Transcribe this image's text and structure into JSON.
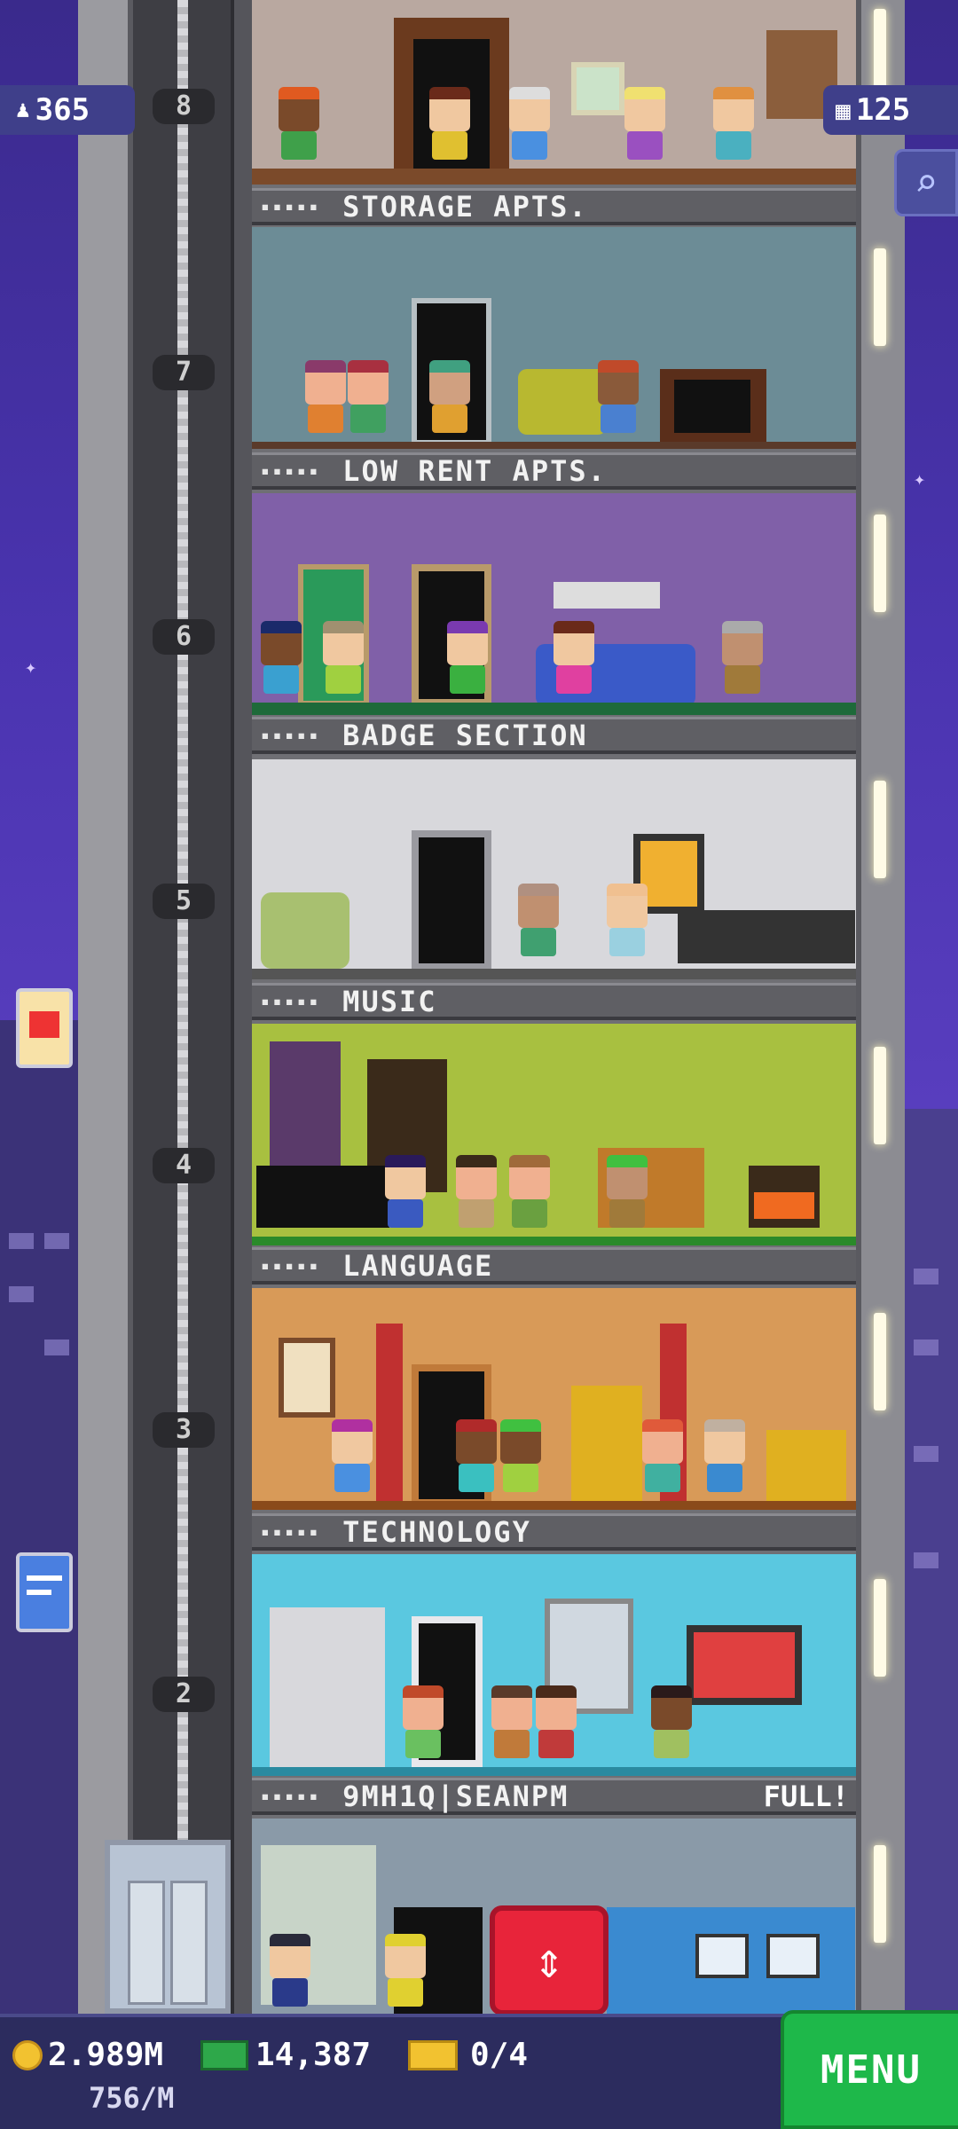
{
  "hud": {
    "population": "365",
    "floors_count": "125"
  },
  "floors": [
    {
      "num": "8",
      "name": "STORAGE APTS.",
      "stars": "▪▪▪▪▪",
      "status": ""
    },
    {
      "num": "7",
      "name": "LOW RENT APTS.",
      "stars": "▪▪▪▪▪",
      "status": ""
    },
    {
      "num": "6",
      "name": "BADGE SECTION",
      "stars": "▪▪▪▪▪",
      "status": ""
    },
    {
      "num": "5",
      "name": "MUSIC",
      "stars": "▪▪▪▪▪",
      "status": ""
    },
    {
      "num": "4",
      "name": "LANGUAGE",
      "stars": "▪▪▪▪▪",
      "status": ""
    },
    {
      "num": "3",
      "name": "TECHNOLOGY",
      "stars": "▪▪▪▪▪",
      "status": ""
    },
    {
      "num": "2",
      "name": "9MH1Q|SEANPM",
      "stars": "▪▪▪▪▪",
      "status": "FULL!"
    }
  ],
  "bottom": {
    "coins": "2.989M",
    "coins_rate": "756/M",
    "bux": "14,387",
    "tickets": "0/4",
    "menu_label": "MENU"
  },
  "colors": {
    "menu_green": "#1eb84a",
    "elevator_red": "#e8243a",
    "hud_blue": "#3f3f8a"
  }
}
